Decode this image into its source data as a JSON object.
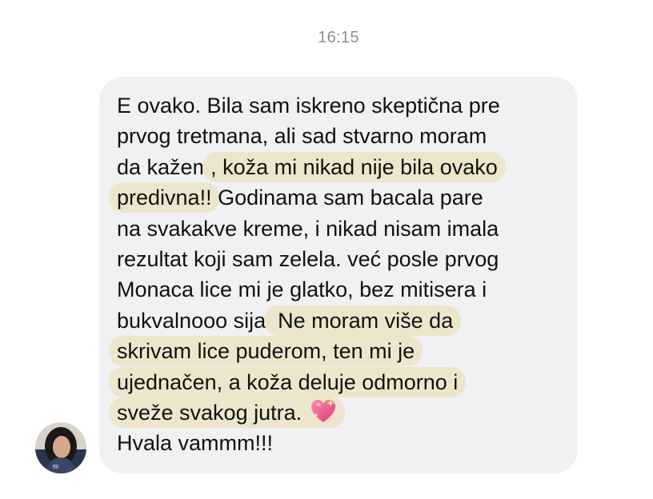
{
  "conversation": {
    "timestamp": "16:15"
  },
  "message": {
    "lines": [
      [
        {
          "text": "E ovako. Bila sam iskreno skeptična pre",
          "hl": false
        }
      ],
      [
        {
          "text": "prvog tretmana, ali sad stvarno moram",
          "hl": false
        }
      ],
      [
        {
          "text": "da kažem",
          "hl": false
        },
        {
          "text": ", koža mi nikad nije bila ovako",
          "hl": true
        }
      ],
      [
        {
          "text": "predivna!!",
          "hl": true
        },
        {
          "text": " Godinama sam bacala pare",
          "hl": false
        }
      ],
      [
        {
          "text": "na svakakve kreme, i nikad nisam imala",
          "hl": false
        }
      ],
      [
        {
          "text": "rezultat koji sam zelela. već posle prvog",
          "hl": false
        }
      ],
      [
        {
          "text": "Monaca lice mi je glatko, bez mitisera i",
          "hl": false
        }
      ],
      [
        {
          "text": "bukvalnooo sija.",
          "hl": false
        },
        {
          "text": " Ne moram više da",
          "hl": true
        }
      ],
      [
        {
          "text": "skrivam lice puderom, ten mi je",
          "hl": true
        }
      ],
      [
        {
          "text": "ujednačen, a koža deluje odmorno i",
          "hl": true
        }
      ],
      [
        {
          "text": "sveže svakog jutra. ",
          "hl": true,
          "emoji": "sparkling-heart"
        }
      ],
      [
        {
          "text": "Hvala vammm!!!",
          "hl": false
        }
      ]
    ],
    "highlight_color": "#ede6cd",
    "bubble_color": "#f1f1f3"
  },
  "sender": {
    "avatar_icon": "avatar"
  }
}
